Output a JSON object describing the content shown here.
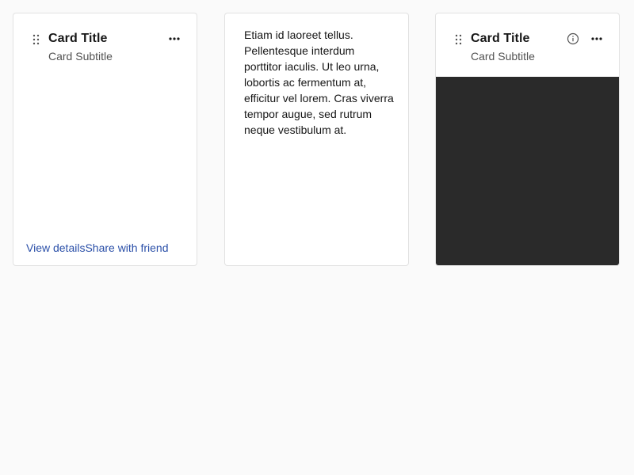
{
  "cards": [
    {
      "title": "Card Title",
      "subtitle": "Card Subtitle",
      "actions": [
        "View details",
        "Share with friend"
      ],
      "icons": [
        "drag-handle-icon",
        "overflow-menu-icon"
      ]
    },
    {
      "body": "Etiam id laoreet tellus. Pellentesque interdum porttitor iaculis. Ut leo urna, lobortis ac fermentum at, efficitur vel lorem. Cras viverra tempor augue, sed rutrum neque vestibulum at."
    },
    {
      "title": "Card Title",
      "subtitle": "Card Subtitle",
      "icons": [
        "drag-handle-icon",
        "info-icon",
        "overflow-menu-icon"
      ],
      "media_color": "#2a2a2a"
    }
  ],
  "colors": {
    "background": "#fafafa",
    "card": "#ffffff",
    "border": "#e2e2e2",
    "link": "#2a4fa8",
    "title": "#161616",
    "subtitle": "#525252"
  }
}
